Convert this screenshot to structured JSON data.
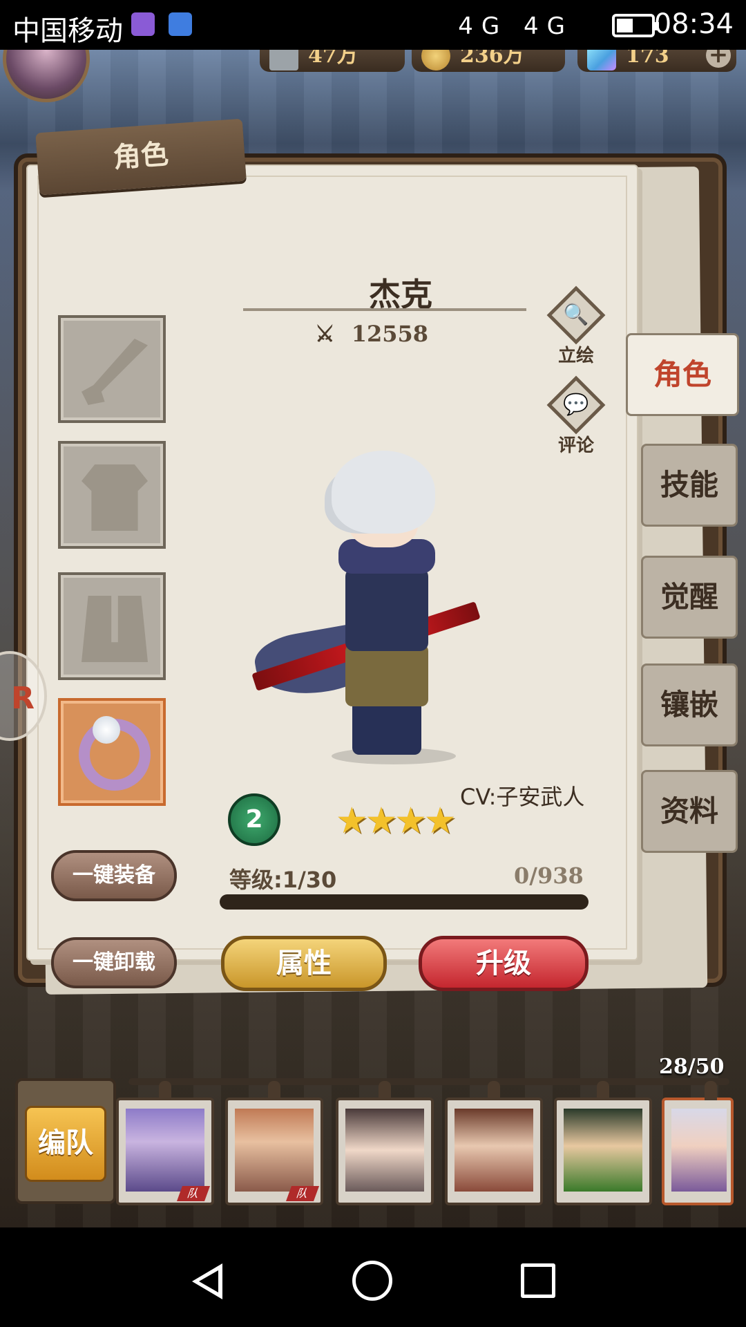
{
  "status_bar": {
    "carrier": "中国移动",
    "network": "4G 4G",
    "battery_level": 0.45,
    "time": "08:34"
  },
  "resources": {
    "power": "47万",
    "gold": "236万",
    "gems": "173",
    "plus": "+"
  },
  "panel": {
    "title": "角色"
  },
  "character": {
    "name": "杰克",
    "power_icon": "⚔",
    "power": "12558",
    "cv": "CV:子安武人",
    "awaken_level": "2",
    "stars": "★★★★",
    "star_count": 4,
    "level_text": "等级:1/30",
    "exp_text": "0/938",
    "exp_progress": 0
  },
  "actions": {
    "portrait": "立绘",
    "portrait_icon": "🔍",
    "comment": "评论",
    "comment_icon": "💬"
  },
  "buttons": {
    "equip_all": "一键装备",
    "unequip_all": "一键卸载",
    "attributes": "属性",
    "upgrade": "升级"
  },
  "tabs": [
    "角色",
    "技能",
    "觉醒",
    "镶嵌",
    "资料"
  ],
  "roster": {
    "count": "28/50",
    "team_button": "编队",
    "team_tag": "队"
  },
  "icons": {
    "slot_weapon": "sword-icon",
    "slot_armor": "armor-icon",
    "slot_boots": "boots-icon",
    "slot_accessory": "ring-icon"
  },
  "colors": {
    "upgrade_button": "#c4262e",
    "attribute_button": "#c9962a",
    "active_tab_text": "#c0442c",
    "stars": "#f3c12b"
  }
}
